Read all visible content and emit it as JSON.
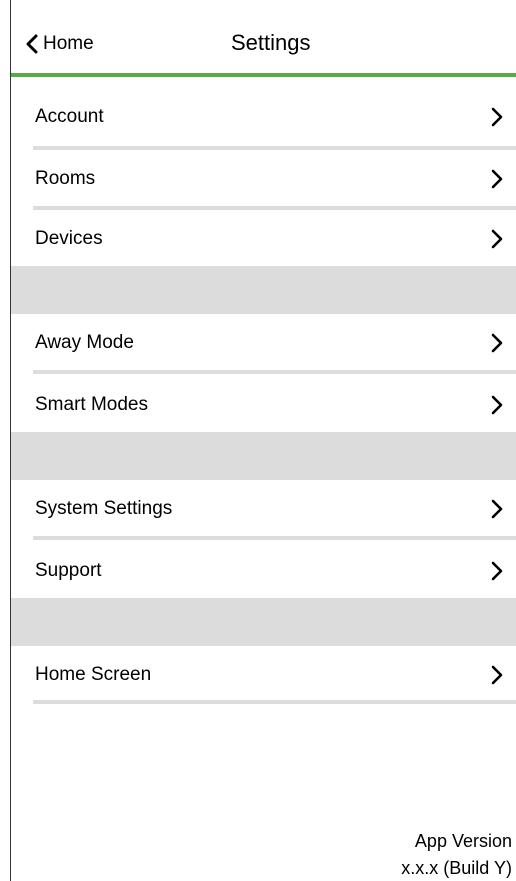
{
  "header": {
    "back_label": "Home",
    "title": "Settings",
    "accent_color": "#5aaa4a"
  },
  "rows": [
    {
      "label": "Account",
      "icon": "chevron-right-icon"
    },
    {
      "label": "Rooms",
      "icon": "chevron-right-icon"
    },
    {
      "label": "Devices",
      "icon": "chevron-right-icon"
    },
    {
      "label": "Away Mode",
      "icon": "chevron-right-icon"
    },
    {
      "label": "Smart Modes",
      "icon": "chevron-right-icon"
    },
    {
      "label": "System Settings",
      "icon": "chevron-right-icon"
    },
    {
      "label": "Support",
      "icon": "chevron-right-icon"
    },
    {
      "label": "Home Screen",
      "icon": "chevron-right-icon"
    }
  ],
  "footer": {
    "version_label": "App Version",
    "version_value": "x.x.x (Build Y)"
  }
}
